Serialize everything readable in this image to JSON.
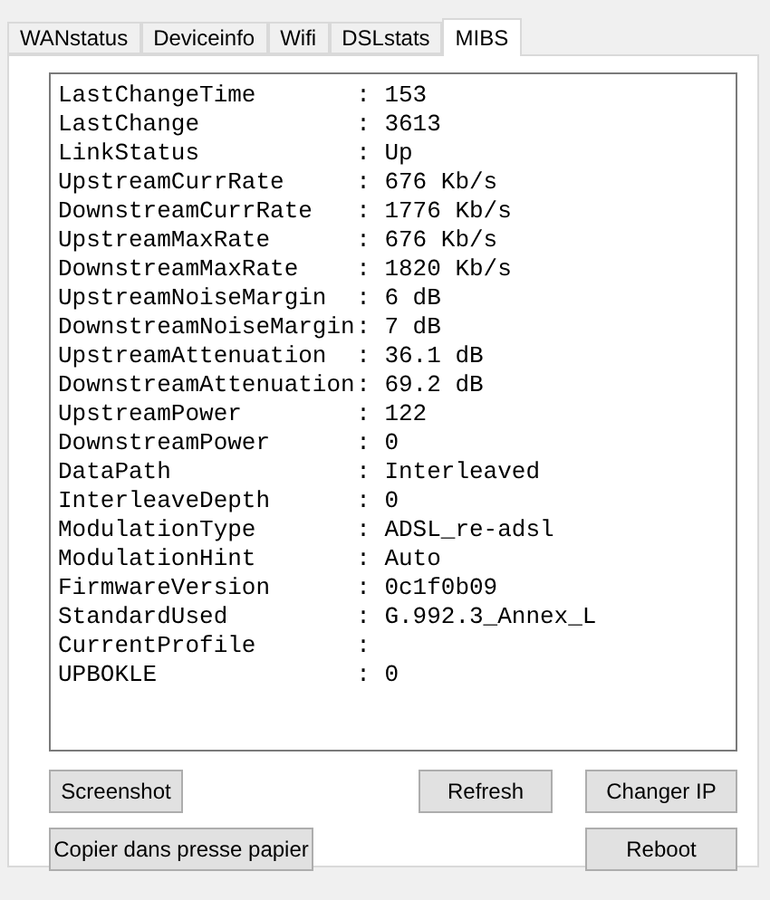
{
  "tabs": [
    {
      "label": "WANstatus",
      "selected": false
    },
    {
      "label": "Deviceinfo",
      "selected": false
    },
    {
      "label": "Wifi",
      "selected": false
    },
    {
      "label": "DSLstats",
      "selected": false
    },
    {
      "label": "MIBS",
      "selected": true
    }
  ],
  "mibs": [
    {
      "key": "LastChangeTime",
      "value": "153"
    },
    {
      "key": "LastChange",
      "value": "3613"
    },
    {
      "key": "LinkStatus",
      "value": "Up"
    },
    {
      "key": "UpstreamCurrRate",
      "value": "676 Kb/s"
    },
    {
      "key": "DownstreamCurrRate",
      "value": "1776 Kb/s"
    },
    {
      "key": "UpstreamMaxRate",
      "value": "676 Kb/s"
    },
    {
      "key": "DownstreamMaxRate",
      "value": "1820 Kb/s"
    },
    {
      "key": "UpstreamNoiseMargin",
      "value": "6 dB"
    },
    {
      "key": "DownstreamNoiseMargin",
      "value": "7 dB"
    },
    {
      "key": "UpstreamAttenuation",
      "value": "36.1 dB"
    },
    {
      "key": "DownstreamAttenuation",
      "value": "69.2 dB"
    },
    {
      "key": "UpstreamPower",
      "value": "122"
    },
    {
      "key": "DownstreamPower",
      "value": "0"
    },
    {
      "key": "DataPath",
      "value": "Interleaved"
    },
    {
      "key": "InterleaveDepth",
      "value": "0"
    },
    {
      "key": "ModulationType",
      "value": "ADSL_re-adsl"
    },
    {
      "key": "ModulationHint",
      "value": "Auto"
    },
    {
      "key": "FirmwareVersion",
      "value": "0c1f0b09"
    },
    {
      "key": "StandardUsed",
      "value": "G.992.3_Annex_L"
    },
    {
      "key": "CurrentProfile"
    },
    {
      "key": "UPBOKLE",
      "value": "0"
    }
  ],
  "separator": ":",
  "buttons": {
    "screenshot": "Screenshot",
    "refresh": "Refresh",
    "change_ip": "Changer IP",
    "copy": "Copier dans presse papier",
    "reboot": "Reboot"
  }
}
